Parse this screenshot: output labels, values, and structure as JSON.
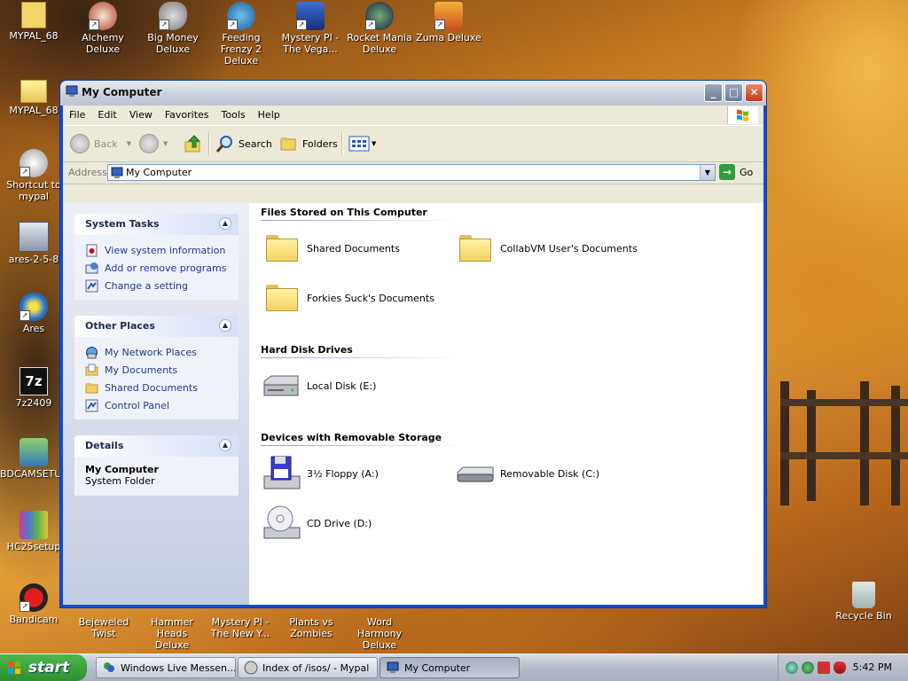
{
  "desktop": {
    "icons_top": [
      {
        "label": "MYPAL_68"
      },
      {
        "label": "Alchemy Deluxe"
      },
      {
        "label": "Big Money Deluxe"
      },
      {
        "label": "Feeding Frenzy 2 Deluxe"
      },
      {
        "label": "Mystery PI - The Vega..."
      },
      {
        "label": "Rocket Mania Deluxe"
      },
      {
        "label": "Zuma Deluxe"
      }
    ],
    "icons_left": [
      {
        "label": "MYPAL_68"
      },
      {
        "label": "Shortcut to mypal"
      },
      {
        "label": "ares-2-5-8"
      },
      {
        "label": "Ares"
      },
      {
        "label": "7z2409"
      },
      {
        "label": "BDCAMSETU..."
      },
      {
        "label": "HC25setup"
      },
      {
        "label": "Bandicam"
      }
    ],
    "icons_bottom": [
      {
        "label": "Bejeweled Twist"
      },
      {
        "label": "Hammer Heads Deluxe"
      },
      {
        "label": "Mystery PI - The New Y..."
      },
      {
        "label": "Plants vs Zombies"
      },
      {
        "label": "Word Harmony Deluxe"
      }
    ],
    "recycle_bin": "Recycle Bin",
    "icon_7z_text": "7z"
  },
  "window": {
    "title": "My Computer",
    "controls": {
      "minimize": "_",
      "maximize": "□",
      "close": "✕"
    },
    "menu": [
      "File",
      "Edit",
      "View",
      "Favorites",
      "Tools",
      "Help"
    ],
    "toolbar": {
      "back": "Back",
      "search": "Search",
      "folders": "Folders"
    },
    "address": {
      "label": "Address",
      "value": "My Computer",
      "go": "Go"
    },
    "panes": {
      "system_tasks": {
        "title": "System Tasks",
        "items": [
          "View system information",
          "Add or remove programs",
          "Change a setting"
        ]
      },
      "other_places": {
        "title": "Other Places",
        "items": [
          "My Network Places",
          "My Documents",
          "Shared Documents",
          "Control Panel"
        ]
      },
      "details": {
        "title": "Details",
        "name": "My Computer",
        "type": "System Folder"
      }
    },
    "sections": {
      "files": {
        "title": "Files Stored on This Computer",
        "items": [
          "Shared Documents",
          "CollabVM User's Documents",
          "Forkies Suck's Documents"
        ]
      },
      "hdd": {
        "title": "Hard Disk Drives",
        "items": [
          "Local Disk (E:)"
        ]
      },
      "removable": {
        "title": "Devices with Removable Storage",
        "items": [
          "3½ Floppy (A:)",
          "Removable Disk (C:)",
          "CD Drive (D:)"
        ]
      }
    }
  },
  "taskbar": {
    "start": "start",
    "tasks": [
      "Windows Live Messen...",
      "Index of /isos/ - Mypal",
      "My Computer"
    ],
    "clock": "5:42 PM"
  },
  "colors": {
    "accent": "#0b4fd6",
    "link": "#1f3b8c",
    "start_green": "#3a9c3a"
  }
}
